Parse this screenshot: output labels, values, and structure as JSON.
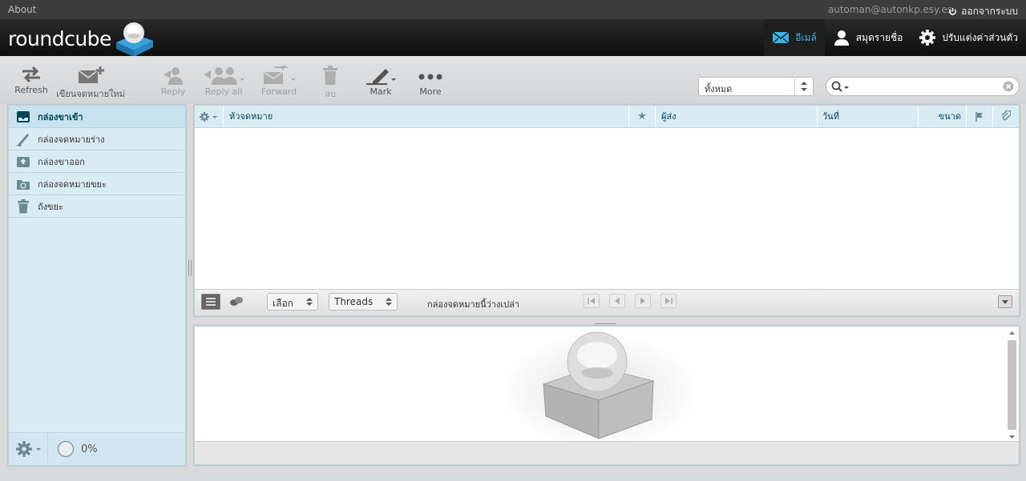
{
  "topline": {
    "about": "About",
    "username": "automan@autonkp.esy.es",
    "logout": "ออกจากระบบ"
  },
  "header": {
    "logo_text": "roundcube",
    "tasks": [
      {
        "label": "อีเมล์",
        "icon": "mail-icon",
        "selected": true
      },
      {
        "label": "สมุดรายชื่อ",
        "icon": "contacts-icon",
        "selected": false
      },
      {
        "label": "ปรับแต่งค่าส่วนตัว",
        "icon": "settings-icon",
        "selected": false
      }
    ]
  },
  "toolbar": {
    "refresh": "Refresh",
    "compose": "เขียนจดหมายใหม่",
    "reply": "Reply",
    "reply_all": "Reply all",
    "forward": "Forward",
    "delete": "ลบ",
    "mark": "Mark",
    "more": "More"
  },
  "filter": {
    "value": "ทั้งหมด"
  },
  "search": {
    "placeholder": ""
  },
  "folders": [
    {
      "label": "กล่องขาเข้า",
      "icon": "inbox-icon",
      "selected": true
    },
    {
      "label": "กล่องจดหมายร่าง",
      "icon": "drafts-icon",
      "selected": false
    },
    {
      "label": "กล่องขาออก",
      "icon": "sent-icon",
      "selected": false
    },
    {
      "label": "กล่องจดหมายขยะ",
      "icon": "junk-icon",
      "selected": false
    },
    {
      "label": "ถังขยะ",
      "icon": "trash-icon",
      "selected": false
    }
  ],
  "quota": {
    "text": "0%",
    "value": 0
  },
  "message_list": {
    "columns": {
      "subject": "หัวจดหมาย",
      "from": "ผู้ส่ง",
      "date": "วันที่",
      "size": "ขนาด"
    },
    "select_label": "เลือก",
    "threads_label": "Threads",
    "status": "กล่องจดหมายนี้ว่างเปล่า"
  },
  "colors": {
    "accent": "#3bb2e5",
    "folder_bg": "#d9ecf4",
    "header_bg": "#1a1a1a"
  }
}
